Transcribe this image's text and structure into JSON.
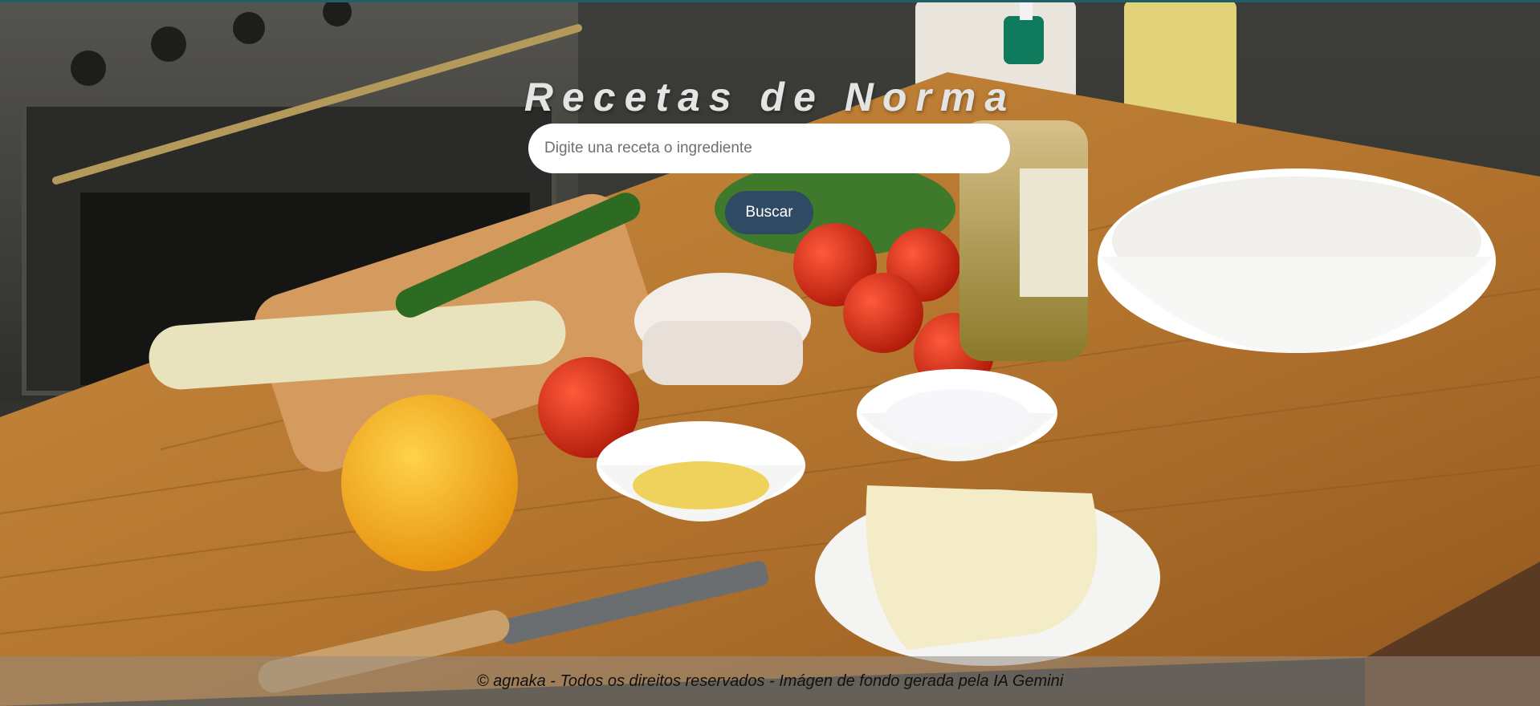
{
  "header": {
    "title": "Recetas de Norma"
  },
  "search": {
    "placeholder": "Digite una receta o ingrediente",
    "value": "",
    "button_label": "Buscar"
  },
  "footer": {
    "text": "© agnaka - Todos os direitos reservados - Imágen de fondo gerada pela IA Gemini"
  },
  "colors": {
    "button_bg": "#2f4a63",
    "title_text": "#e4e4e4",
    "top_strip": "#1f5f6a"
  }
}
